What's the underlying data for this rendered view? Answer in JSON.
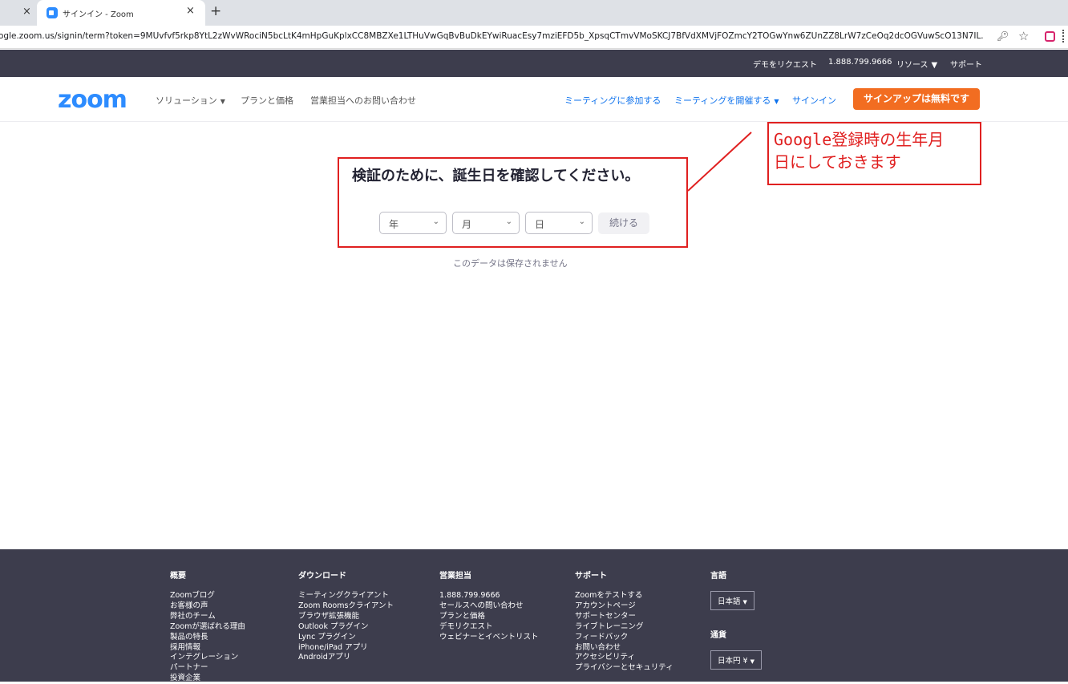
{
  "browser": {
    "prev_tab_close": "×",
    "tab_title": "サインイン - Zoom",
    "tab_close": "×",
    "new_tab": "+",
    "url": "ogle.zoom.us/signin/term?token=9MUvfvf5rkp8YtL2zWvWRociN5bcLtK4mHpGuKplxCC8MBZXe1LTHuVwGqBvBuDkEYwiRuacEsy7mziEFD5b_XpsqCTmvVMoSKCJ7BfVdXMVjFOZmcY2TOGwYnw6ZUnZZ8LrW7zCeOq2dcOGVuwScO13N7IL...",
    "key_icon": "key-icon",
    "star_icon": "star-icon",
    "ext_icon": "extension-icon"
  },
  "topbar": {
    "request_demo": "デモをリクエスト",
    "phone": "1.888.799.9666",
    "resources": "リソース",
    "support": "サポート"
  },
  "nav": {
    "logo": "zoom",
    "solutions": "ソリューション",
    "plans": "プランと価格",
    "contact_sales": "営業担当へのお問い合わせ",
    "join_meeting": "ミーティングに参加する",
    "host_meeting": "ミーティングを開催する",
    "sign_in": "サインイン",
    "sign_up": "サインアップは無料です"
  },
  "verify": {
    "heading": "検証のために、誕生日を確認してください。",
    "year": "年",
    "month": "月",
    "day": "日",
    "continue": "続ける",
    "note": "このデータは保存されません"
  },
  "annotation": {
    "line1": "Google登録時の生年月",
    "line2": "日にしておきます",
    "color": "#e02020"
  },
  "footer": {
    "about": {
      "heading": "概要",
      "items": [
        "Zoomブログ",
        "お客様の声",
        "弊社のチーム",
        "Zoomが選ばれる理由",
        "製品の特長",
        "採用情報",
        "インテグレーション",
        "パートナー",
        "投資企業"
      ]
    },
    "download": {
      "heading": "ダウンロード",
      "items": [
        "ミーティングクライアント",
        "Zoom Roomsクライアント",
        "ブラウザ拡張機能",
        "Outlook プラグイン",
        "Lync プラグイン",
        "iPhone/iPad アプリ",
        "Androidアプリ"
      ]
    },
    "sales": {
      "heading": "営業担当",
      "items": [
        "1.888.799.9666",
        "セールスへの問い合わせ",
        "プランと価格",
        "デモリクエスト",
        "ウェビナーとイベントリスト"
      ]
    },
    "support": {
      "heading": "サポート",
      "items": [
        "Zoomをテストする",
        "アカウントページ",
        "サポートセンター",
        "ライブトレーニング",
        "フィードバック",
        "お問い合わせ",
        "アクセシビリティ",
        "プライバシーとセキュリティ"
      ]
    },
    "language": {
      "heading": "言語",
      "selected": "日本語"
    },
    "currency": {
      "heading": "通貨",
      "selected": "日本円 ¥"
    }
  },
  "colors": {
    "brand": "#2d8cff",
    "link": "#0e72ed",
    "signup": "#f26d21",
    "dark_bar": "#3d3d4d"
  }
}
